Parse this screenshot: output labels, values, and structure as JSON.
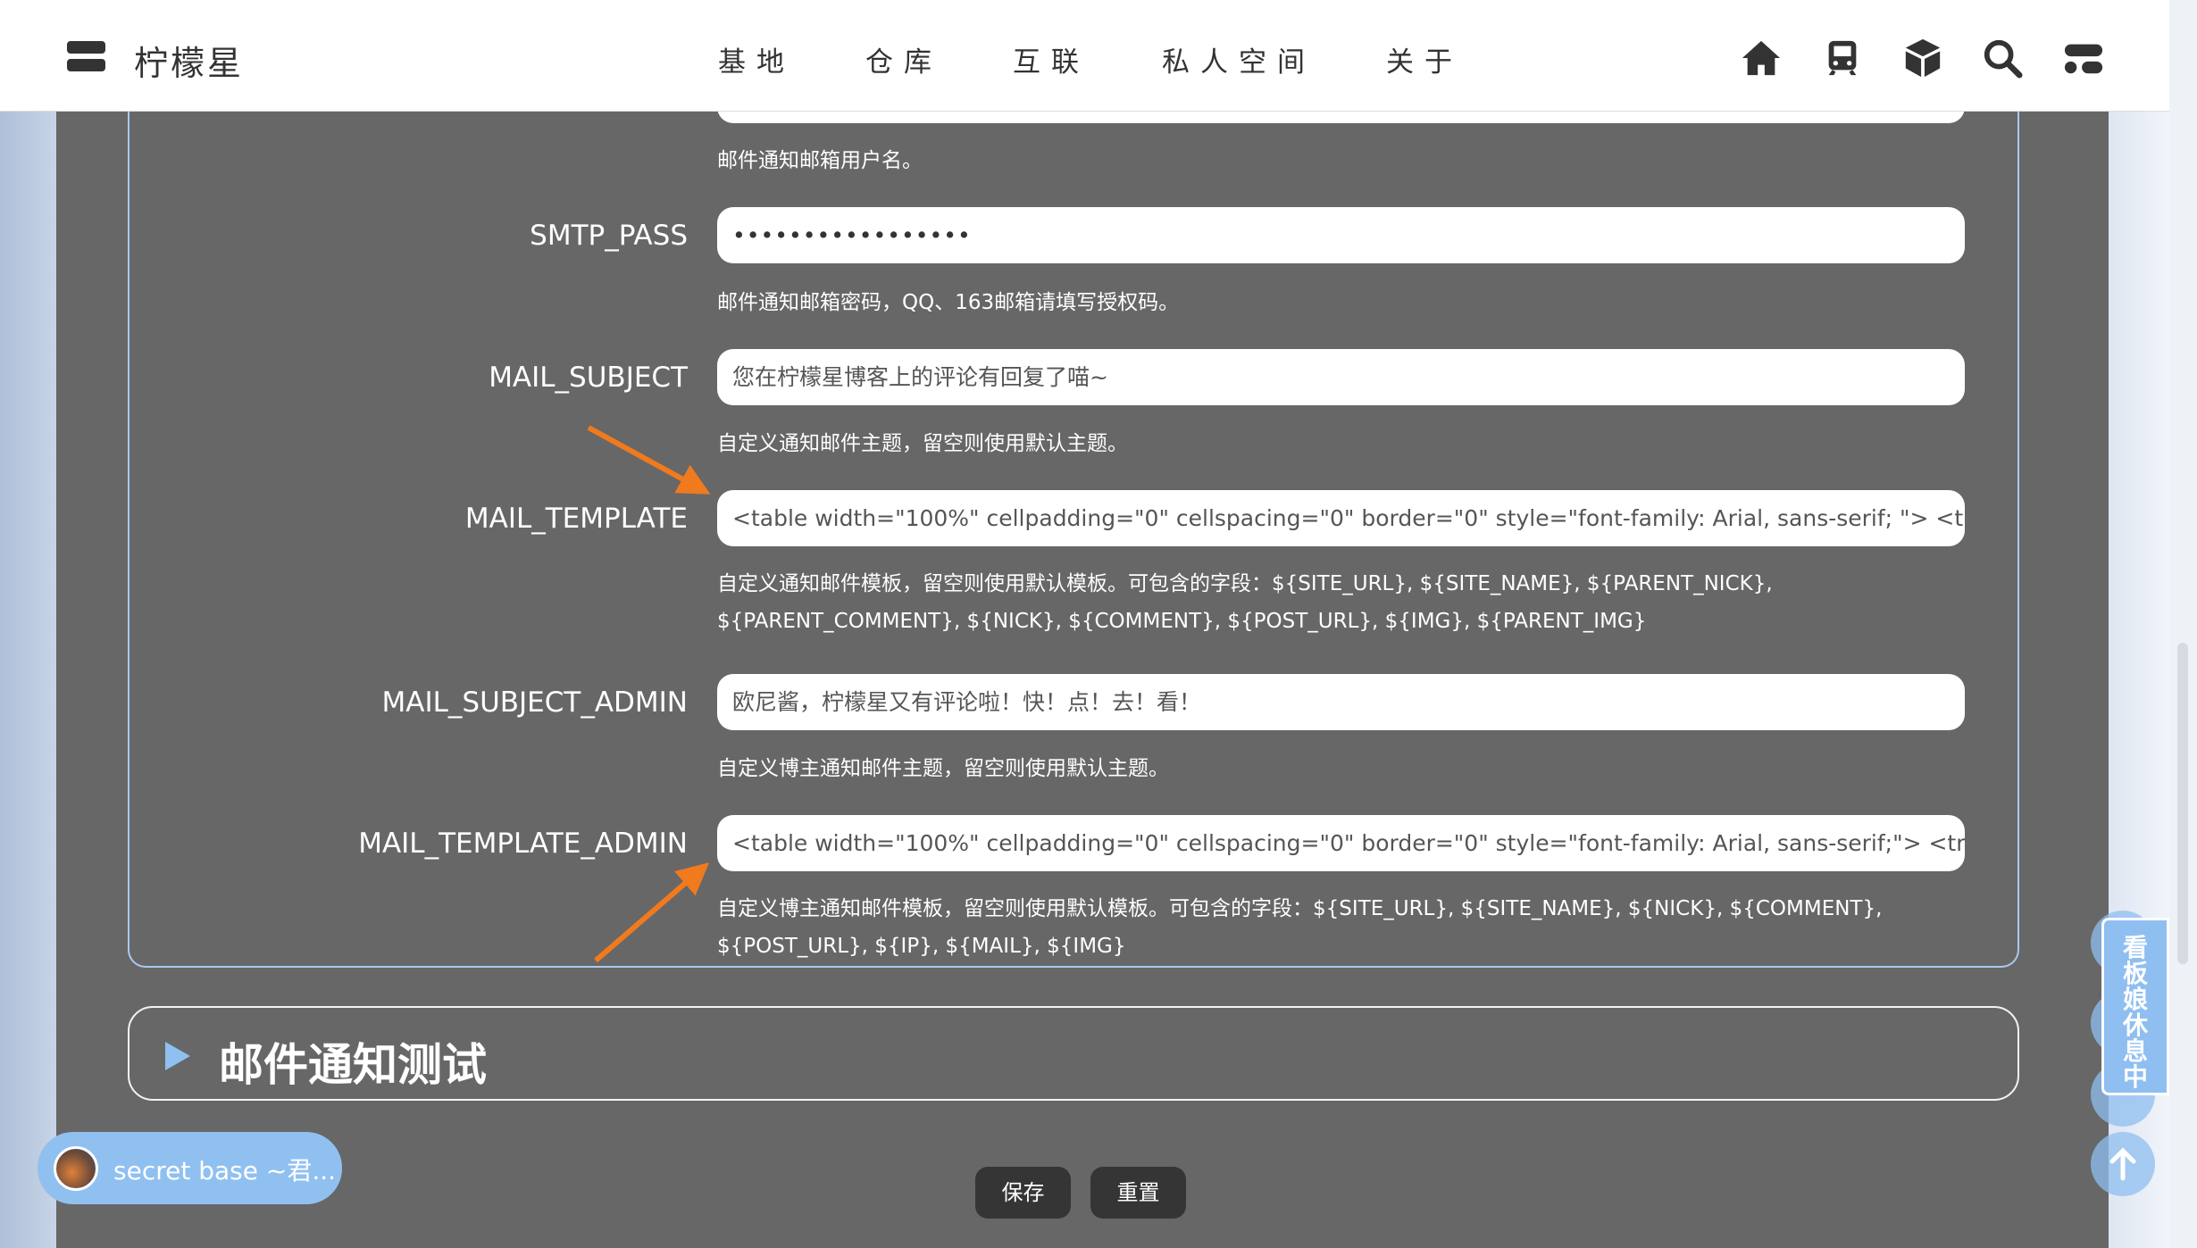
{
  "header": {
    "title": "柠檬星",
    "nav": [
      "基地",
      "仓库",
      "互联",
      "私人空间",
      "关于"
    ],
    "icons": [
      "home-icon",
      "train-icon",
      "cube-icon",
      "search-icon",
      "toggle-icon"
    ]
  },
  "settings": {
    "smtp_user_desc": "邮件通知邮箱用户名。",
    "rows": [
      {
        "label": "SMTP_PASS",
        "value": "•••••••••••••••••",
        "desc": "邮件通知邮箱密码，QQ、163邮箱请填写授权码。"
      },
      {
        "label": "MAIL_SUBJECT",
        "value": "您在柠檬星博客上的评论有回复了喵~",
        "desc": "自定义通知邮件主题，留空则使用默认主题。"
      },
      {
        "label": "MAIL_TEMPLATE",
        "value": "<table width=\"100%\" cellpadding=\"0\" cellspacing=\"0\" border=\"0\" style=\"font-family: Arial, sans-serif; \"> <tr> <td",
        "desc": "自定义通知邮件模板，留空则使用默认模板。可包含的字段：${SITE_URL}, ${SITE_NAME}, ${PARENT_NICK},",
        "desc2": "${PARENT_COMMENT}, ${NICK}, ${COMMENT}, ${POST_URL}, ${IMG}, ${PARENT_IMG}"
      },
      {
        "label": "MAIL_SUBJECT_ADMIN",
        "value": "欧尼酱，柠檬星又有评论啦！快！点！去！看！",
        "desc": "自定义博主通知邮件主题，留空则使用默认主题。"
      },
      {
        "label": "MAIL_TEMPLATE_ADMIN",
        "value": "<table width=\"100%\" cellpadding=\"0\" cellspacing=\"0\" border=\"0\" style=\"font-family: Arial, sans-serif;\"> <tr> <td",
        "desc": "自定义博主通知邮件模板，留空则使用默认模板。可包含的字段：${SITE_URL}, ${SITE_NAME}, ${NICK}, ${COMMENT},",
        "desc2": "${POST_URL}, ${IP}, ${MAIL}, ${IMG}"
      }
    ]
  },
  "test_section": {
    "title": "邮件通知测试"
  },
  "music": {
    "title": "secret base ~君..."
  },
  "buttons": {
    "save": "保存",
    "reset": "重置"
  },
  "kanban": {
    "label": "看板娘休息中"
  },
  "colors": {
    "accent": "#8fc0f0",
    "arrow": "#f07a1e",
    "overlay": "#676767"
  }
}
